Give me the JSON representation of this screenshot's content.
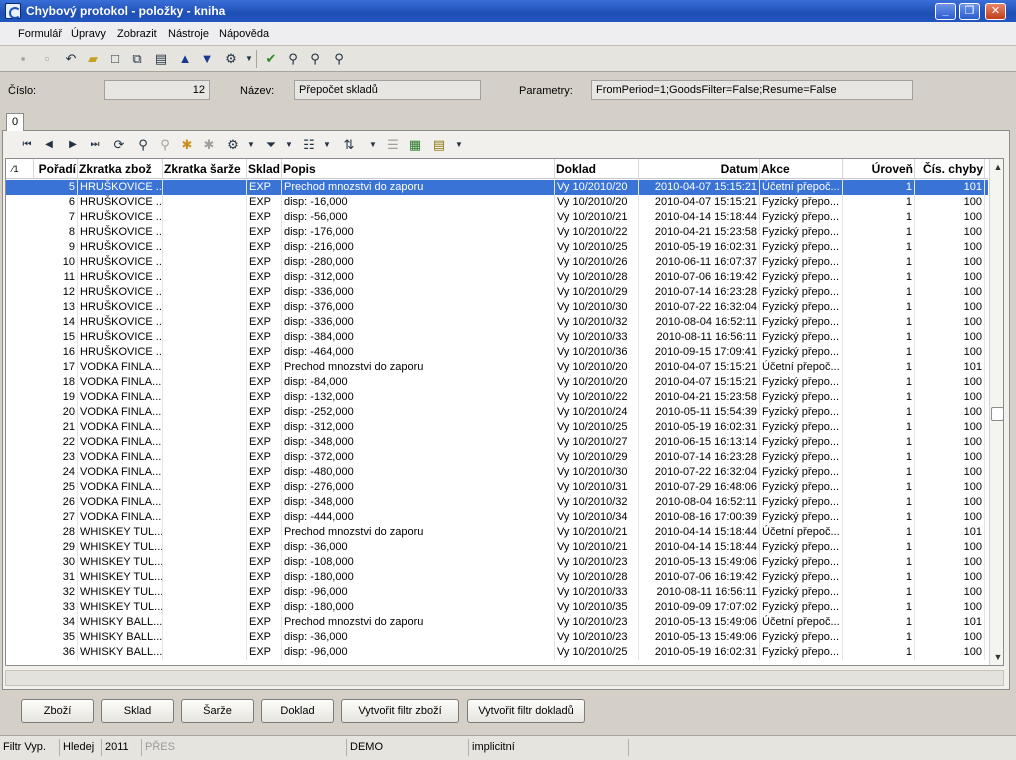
{
  "window": {
    "title": "Chybový protokol - položky - kniha",
    "minimize": "_",
    "maximize": "❐",
    "close": "✕"
  },
  "menu": [
    {
      "label": "Formulář"
    },
    {
      "label": "Úpravy"
    },
    {
      "label": "Zobrazit"
    },
    {
      "label": "Nástroje"
    },
    {
      "label": "Nápověda"
    }
  ],
  "toolbar_icons": [
    "save-icon",
    "save-as-icon",
    "undo-icon",
    "open-folder-icon",
    "new-document-icon",
    "copy-document-icon",
    "preview-icon",
    "arrow-up-icon",
    "arrow-down-icon",
    "tools-icon",
    "dropdown-icon",
    "check-icon",
    "find-icon",
    "find-next-icon",
    "find-options-icon"
  ],
  "header": {
    "cislo_label": "Číslo:",
    "cislo_value": "12",
    "nazev_label": "Název:",
    "nazev_value": "Přepočet skladů",
    "parametry_label": "Parametry:",
    "parametry_value": "FromPeriod=1;GoodsFilter=False;Resume=False"
  },
  "tab": {
    "label": "0"
  },
  "grid": {
    "sort_marker": "⁄1",
    "columns": [
      "Pořadí",
      "Zkratka zbož",
      "Zkratka šarže",
      "Sklad",
      "Popis",
      "Doklad",
      "Datum",
      "Akce",
      "Úroveň",
      "Čís. chyby"
    ],
    "rows": [
      [
        "5",
        "HRUŠKOVICE ...",
        "",
        "EXP",
        "Prechod mnozstvi do zaporu",
        "Vy 10/2010/20",
        "2010-04-07 15:15:21",
        "Účetní přepoč...",
        "1",
        "101"
      ],
      [
        "6",
        "HRUŠKOVICE ...",
        "",
        "EXP",
        "disp: -16,000",
        "Vy 10/2010/20",
        "2010-04-07 15:15:21",
        "Fyzický přepo...",
        "1",
        "100"
      ],
      [
        "7",
        "HRUŠKOVICE ...",
        "",
        "EXP",
        "disp: -56,000",
        "Vy 10/2010/21",
        "2010-04-14 15:18:44",
        "Fyzický přepo...",
        "1",
        "100"
      ],
      [
        "8",
        "HRUŠKOVICE ...",
        "",
        "EXP",
        "disp: -176,000",
        "Vy 10/2010/22",
        "2010-04-21 15:23:58",
        "Fyzický přepo...",
        "1",
        "100"
      ],
      [
        "9",
        "HRUŠKOVICE ...",
        "",
        "EXP",
        "disp: -216,000",
        "Vy 10/2010/25",
        "2010-05-19 16:02:31",
        "Fyzický přepo...",
        "1",
        "100"
      ],
      [
        "10",
        "HRUŠKOVICE ...",
        "",
        "EXP",
        "disp: -280,000",
        "Vy 10/2010/26",
        "2010-06-11 16:07:37",
        "Fyzický přepo...",
        "1",
        "100"
      ],
      [
        "11",
        "HRUŠKOVICE ...",
        "",
        "EXP",
        "disp: -312,000",
        "Vy 10/2010/28",
        "2010-07-06 16:19:42",
        "Fyzický přepo...",
        "1",
        "100"
      ],
      [
        "12",
        "HRUŠKOVICE ...",
        "",
        "EXP",
        "disp: -336,000",
        "Vy 10/2010/29",
        "2010-07-14 16:23:28",
        "Fyzický přepo...",
        "1",
        "100"
      ],
      [
        "13",
        "HRUŠKOVICE ...",
        "",
        "EXP",
        "disp: -376,000",
        "Vy 10/2010/30",
        "2010-07-22 16:32:04",
        "Fyzický přepo...",
        "1",
        "100"
      ],
      [
        "14",
        "HRUŠKOVICE ...",
        "",
        "EXP",
        "disp: -336,000",
        "Vy 10/2010/32",
        "2010-08-04 16:52:11",
        "Fyzický přepo...",
        "1",
        "100"
      ],
      [
        "15",
        "HRUŠKOVICE ...",
        "",
        "EXP",
        "disp: -384,000",
        "Vy 10/2010/33",
        "2010-08-11 16:56:11",
        "Fyzický přepo...",
        "1",
        "100"
      ],
      [
        "16",
        "HRUŠKOVICE ...",
        "",
        "EXP",
        "disp: -464,000",
        "Vy 10/2010/36",
        "2010-09-15 17:09:41",
        "Fyzický přepo...",
        "1",
        "100"
      ],
      [
        "17",
        "VODKA FINLA...",
        "",
        "EXP",
        "Prechod mnozstvi do zaporu",
        "Vy 10/2010/20",
        "2010-04-07 15:15:21",
        "Účetní přepoč...",
        "1",
        "101"
      ],
      [
        "18",
        "VODKA FINLA...",
        "",
        "EXP",
        "disp: -84,000",
        "Vy 10/2010/20",
        "2010-04-07 15:15:21",
        "Fyzický přepo...",
        "1",
        "100"
      ],
      [
        "19",
        "VODKA FINLA...",
        "",
        "EXP",
        "disp: -132,000",
        "Vy 10/2010/22",
        "2010-04-21 15:23:58",
        "Fyzický přepo...",
        "1",
        "100"
      ],
      [
        "20",
        "VODKA FINLA...",
        "",
        "EXP",
        "disp: -252,000",
        "Vy 10/2010/24",
        "2010-05-11 15:54:39",
        "Fyzický přepo...",
        "1",
        "100"
      ],
      [
        "21",
        "VODKA FINLA...",
        "",
        "EXP",
        "disp: -312,000",
        "Vy 10/2010/25",
        "2010-05-19 16:02:31",
        "Fyzický přepo...",
        "1",
        "100"
      ],
      [
        "22",
        "VODKA FINLA...",
        "",
        "EXP",
        "disp: -348,000",
        "Vy 10/2010/27",
        "2010-06-15 16:13:14",
        "Fyzický přepo...",
        "1",
        "100"
      ],
      [
        "23",
        "VODKA FINLA...",
        "",
        "EXP",
        "disp: -372,000",
        "Vy 10/2010/29",
        "2010-07-14 16:23:28",
        "Fyzický přepo...",
        "1",
        "100"
      ],
      [
        "24",
        "VODKA FINLA...",
        "",
        "EXP",
        "disp: -480,000",
        "Vy 10/2010/30",
        "2010-07-22 16:32:04",
        "Fyzický přepo...",
        "1",
        "100"
      ],
      [
        "25",
        "VODKA FINLA...",
        "",
        "EXP",
        "disp: -276,000",
        "Vy 10/2010/31",
        "2010-07-29 16:48:06",
        "Fyzický přepo...",
        "1",
        "100"
      ],
      [
        "26",
        "VODKA FINLA...",
        "",
        "EXP",
        "disp: -348,000",
        "Vy 10/2010/32",
        "2010-08-04 16:52:11",
        "Fyzický přepo...",
        "1",
        "100"
      ],
      [
        "27",
        "VODKA FINLA...",
        "",
        "EXP",
        "disp: -444,000",
        "Vy 10/2010/34",
        "2010-08-16 17:00:39",
        "Fyzický přepo...",
        "1",
        "100"
      ],
      [
        "28",
        "WHISKEY TUL...",
        "",
        "EXP",
        "Prechod mnozstvi do zaporu",
        "Vy 10/2010/21",
        "2010-04-14 15:18:44",
        "Účetní přepoč...",
        "1",
        "101"
      ],
      [
        "29",
        "WHISKEY TUL...",
        "",
        "EXP",
        "disp: -36,000",
        "Vy 10/2010/21",
        "2010-04-14 15:18:44",
        "Fyzický přepo...",
        "1",
        "100"
      ],
      [
        "30",
        "WHISKEY TUL...",
        "",
        "EXP",
        "disp: -108,000",
        "Vy 10/2010/23",
        "2010-05-13 15:49:06",
        "Fyzický přepo...",
        "1",
        "100"
      ],
      [
        "31",
        "WHISKEY TUL...",
        "",
        "EXP",
        "disp: -180,000",
        "Vy 10/2010/28",
        "2010-07-06 16:19:42",
        "Fyzický přepo...",
        "1",
        "100"
      ],
      [
        "32",
        "WHISKEY TUL...",
        "",
        "EXP",
        "disp: -96,000",
        "Vy 10/2010/33",
        "2010-08-11 16:56:11",
        "Fyzický přepo...",
        "1",
        "100"
      ],
      [
        "33",
        "WHISKEY TUL...",
        "",
        "EXP",
        "disp: -180,000",
        "Vy 10/2010/35",
        "2010-09-09 17:07:02",
        "Fyzický přepo...",
        "1",
        "100"
      ],
      [
        "34",
        "WHISKY BALL...",
        "",
        "EXP",
        "Prechod mnozstvi do zaporu",
        "Vy 10/2010/23",
        "2010-05-13 15:49:06",
        "Účetní přepoč...",
        "1",
        "101"
      ],
      [
        "35",
        "WHISKY BALL...",
        "",
        "EXP",
        "disp: -36,000",
        "Vy 10/2010/23",
        "2010-05-13 15:49:06",
        "Fyzický přepo...",
        "1",
        "100"
      ],
      [
        "36",
        "WHISKY BALL...",
        "",
        "EXP",
        "disp: -96,000",
        "Vy 10/2010/25",
        "2010-05-19 16:02:31",
        "Fyzický přepo...",
        "1",
        "100"
      ]
    ],
    "selected_row": 0
  },
  "buttons": [
    {
      "label": "Zboží"
    },
    {
      "label": "Sklad"
    },
    {
      "label": "Šarže"
    },
    {
      "label": "Doklad"
    },
    {
      "label": "Vytvořit filtr zboží"
    },
    {
      "label": "Vytvořit filtr dokladů"
    }
  ],
  "status": {
    "filtr": "Filtr Vyp.",
    "hledej": "Hledej",
    "year": "2011",
    "pres": "PŘES",
    "db": "DEMO",
    "mode": "implicitní"
  }
}
